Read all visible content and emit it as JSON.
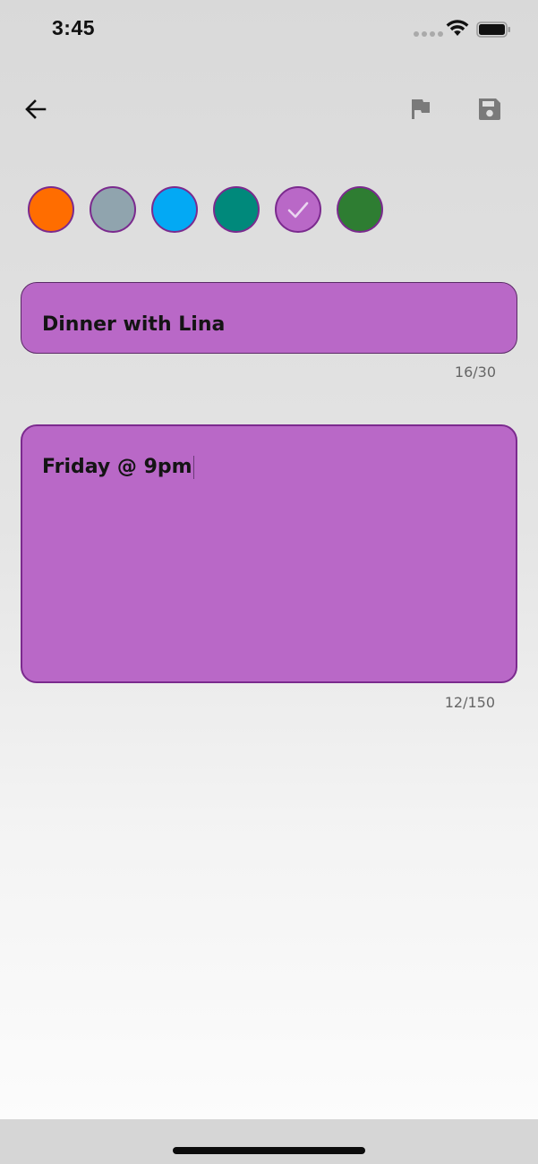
{
  "status_bar": {
    "time": "3:45"
  },
  "toolbar": {
    "back_icon": "arrow-left-icon",
    "flag_icon": "flag-icon",
    "save_icon": "floppy-disk-icon"
  },
  "colors": {
    "swatches": [
      "#ff6d00",
      "#90a4ae",
      "#03a9f4",
      "#00897b",
      "#b968c7",
      "#2e7d32"
    ],
    "selected_index": 4,
    "border": "#7b2a8e",
    "field_background": "#b968c7"
  },
  "note": {
    "title": "Dinner with Lina",
    "title_counter": "16/30",
    "body": "Friday @ 9pm",
    "body_counter": "12/150"
  }
}
